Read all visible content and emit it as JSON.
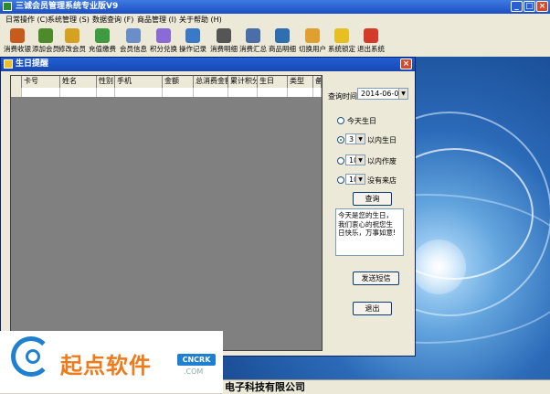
{
  "app": {
    "title": "三诚会员管理系统专业版V9"
  },
  "menu": [
    "日常操作 (C)",
    "系统管理 (S)",
    "数据查询 (F)",
    "商品管理 (I)",
    "关于帮助 (H)"
  ],
  "toolbar": [
    {
      "label": "消费收银",
      "icon": "cashier-icon",
      "color": "#c85a1e"
    },
    {
      "label": "添加会员",
      "icon": "add-member-icon",
      "color": "#4d8a2a"
    },
    {
      "label": "修改会员",
      "icon": "edit-member-icon",
      "color": "#d6a020"
    },
    {
      "label": "充值缴费",
      "icon": "recharge-icon",
      "color": "#3f9b3f"
    },
    {
      "label": "会员信息",
      "icon": "member-info-icon",
      "color": "#6a8fc8"
    },
    {
      "label": "积分兑换",
      "icon": "points-exchange-icon",
      "color": "#8a6ad6"
    },
    {
      "label": "操作记录",
      "icon": "operation-log-icon",
      "color": "#3a78c8"
    },
    {
      "label": "消费明细",
      "icon": "consumption-detail-icon",
      "color": "#555555"
    },
    {
      "label": "消费汇总",
      "icon": "consumption-summary-icon",
      "color": "#4a6ea8"
    },
    {
      "label": "商品明细",
      "icon": "product-detail-icon",
      "color": "#2f6fb0"
    },
    {
      "label": "切换用户",
      "icon": "switch-user-icon",
      "color": "#e0a030"
    },
    {
      "label": "系统锁定",
      "icon": "system-lock-icon",
      "color": "#e6c020"
    },
    {
      "label": "退出系统",
      "icon": "exit-icon",
      "color": "#d43a2a"
    }
  ],
  "dialog": {
    "title": "生日提醒",
    "columns": [
      "卡号",
      "姓名",
      "性别",
      "手机",
      "金额",
      "总消费金额",
      "累计积分",
      "生日",
      "类型",
      "备"
    ],
    "query_time_label": "查询时间",
    "query_date": "2014-06-08",
    "options": {
      "today": "今天生日",
      "within_value": "3",
      "within_label": "以内生日",
      "late_value": "10",
      "late_label": "以内作废",
      "absent_value": "10",
      "absent_label": "没有来店"
    },
    "query_button": "查询",
    "message": "今天是您的生日，\n我们衷心的祝您生\n日快乐，万事如意!",
    "send_sms_button": "发送短信",
    "exit_button": "退出"
  },
  "watermark": {
    "brand": "起点软件",
    "badge": "CNCRK",
    "domain": ".COM"
  },
  "footer": {
    "company": "电子科技有限公司"
  }
}
